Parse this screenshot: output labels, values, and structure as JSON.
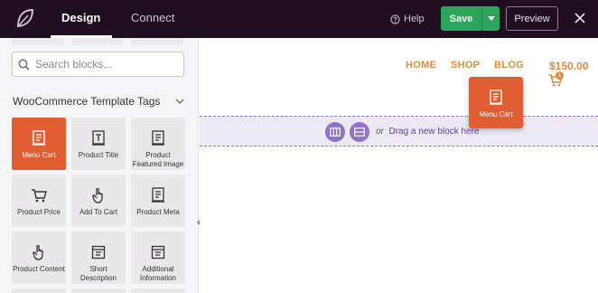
{
  "topbar": {
    "tabs": [
      {
        "label": "Design",
        "active": true
      },
      {
        "label": "Connect",
        "active": false
      }
    ],
    "help_label": "Help",
    "save_label": "Save",
    "preview_label": "Preview",
    "colors": {
      "bar": "#1f0f20",
      "save": "#2aa55b"
    }
  },
  "sidebar": {
    "search": {
      "placeholder": "Search blocks...",
      "value": ""
    },
    "section_title": "WooCommerce Template Tags",
    "blocks": [
      {
        "label": "Menu Cart",
        "icon": "document-icon",
        "active": true
      },
      {
        "label": "Product Title",
        "icon": "title-icon",
        "active": false
      },
      {
        "label": "Product Featured Image",
        "icon": "document-icon",
        "active": false
      },
      {
        "label": "Product Price",
        "icon": "cart-icon",
        "active": false
      },
      {
        "label": "Add To Cart",
        "icon": "hand-pointer-icon",
        "active": false
      },
      {
        "label": "Product Meta",
        "icon": "document-icon",
        "active": false
      },
      {
        "label": "Product Content",
        "icon": "hand-pointer-icon",
        "active": false
      },
      {
        "label": "Short Description",
        "icon": "window-icon",
        "active": false
      },
      {
        "label": "Additional Information",
        "icon": "window-icon",
        "active": false
      }
    ],
    "accent_color": "#e15e33"
  },
  "canvas": {
    "nav": [
      "HOME",
      "SHOP",
      "BLOG"
    ],
    "price": "$150.00",
    "cart_count": "1",
    "dropzone": {
      "or_text": "or",
      "link_text": "Drag a new block here"
    },
    "drag_ghost_label": "Menu Cart",
    "nav_color": "#e08a3c"
  }
}
